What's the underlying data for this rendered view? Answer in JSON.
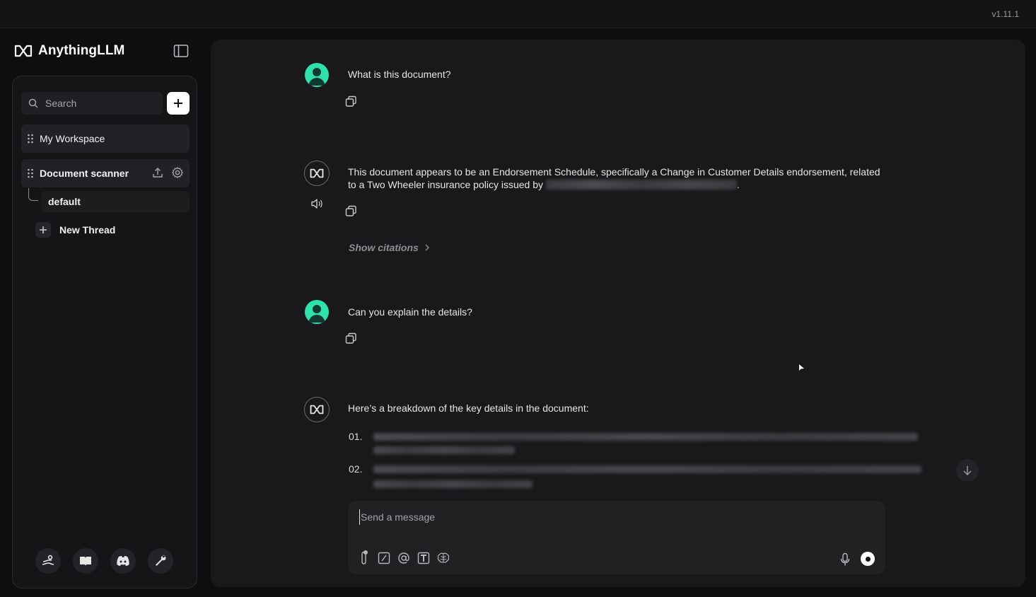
{
  "app": {
    "version": "v1.11.1",
    "brand": "AnythingLLM"
  },
  "sidebar": {
    "search_label": "Search",
    "workspaces": [
      {
        "label": "My Workspace"
      },
      {
        "label": "Document scanner"
      }
    ],
    "threads": [
      {
        "label": "default"
      }
    ],
    "new_thread_label": "New Thread",
    "footer_icons": [
      "community-hub-icon",
      "docs-book-icon",
      "discord-icon",
      "settings-wrench-icon"
    ]
  },
  "chat": {
    "messages": [
      {
        "role": "user",
        "text": "What is this document?"
      },
      {
        "role": "assistant",
        "text_line1": "This document appears to be an Endorsement Schedule, specifically a Change in Customer Details endorsement, related",
        "text_line2": "to a Two Wheeler insurance policy issued by",
        "text_tail": "."
      },
      {
        "role": "user",
        "text": "Can you explain the details?"
      },
      {
        "role": "assistant",
        "text": "Here’s a breakdown of the key details in the document:",
        "list_numbers": [
          "01.",
          "02."
        ]
      }
    ],
    "show_citations_label": "Show citations"
  },
  "composer": {
    "placeholder": "Send a message"
  },
  "colors": {
    "accent_user_avatar": "#2ee2ae",
    "background": "#0e0e10",
    "panel": "#19191b"
  }
}
